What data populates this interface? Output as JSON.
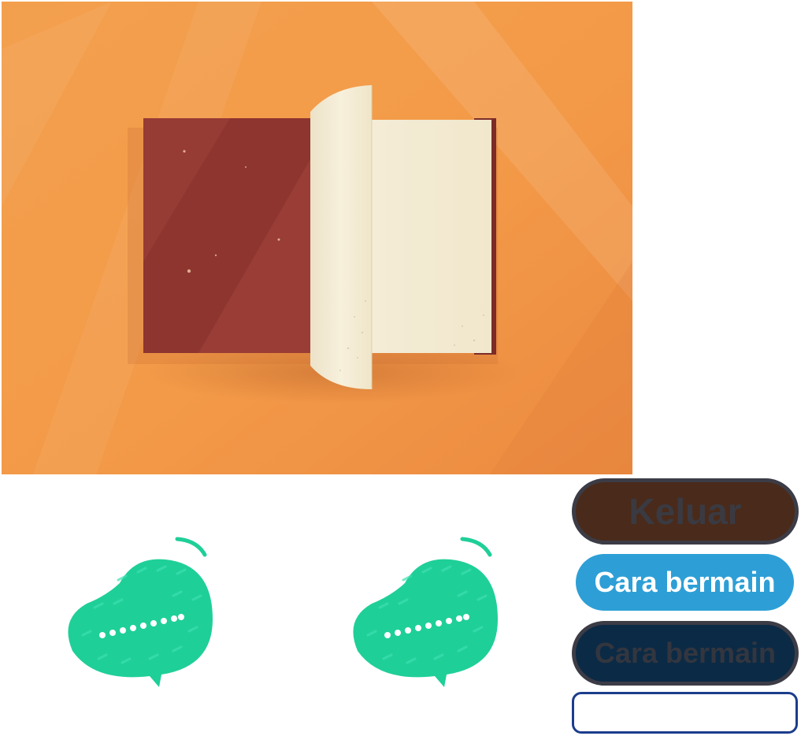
{
  "buttons": {
    "keluar": "Keluar",
    "cara_bermain": "Cara bermain",
    "cara_bermain_dark": "Cara bermain"
  },
  "text_field": {
    "value": ""
  },
  "colors": {
    "background_orange": "#f39f4c",
    "book_cover": "#8e3530",
    "book_page": "#f3ead4",
    "bubble_green": "#1fcf98",
    "keluar_bg": "#4a2a1a",
    "cara_bg": "#2d9fd6",
    "cara_dark_bg": "#0b2a45",
    "field_border": "#1c3d8c"
  },
  "icons": {
    "cover": "open-book-illustration",
    "bubble": "speech-bubble-icon"
  }
}
